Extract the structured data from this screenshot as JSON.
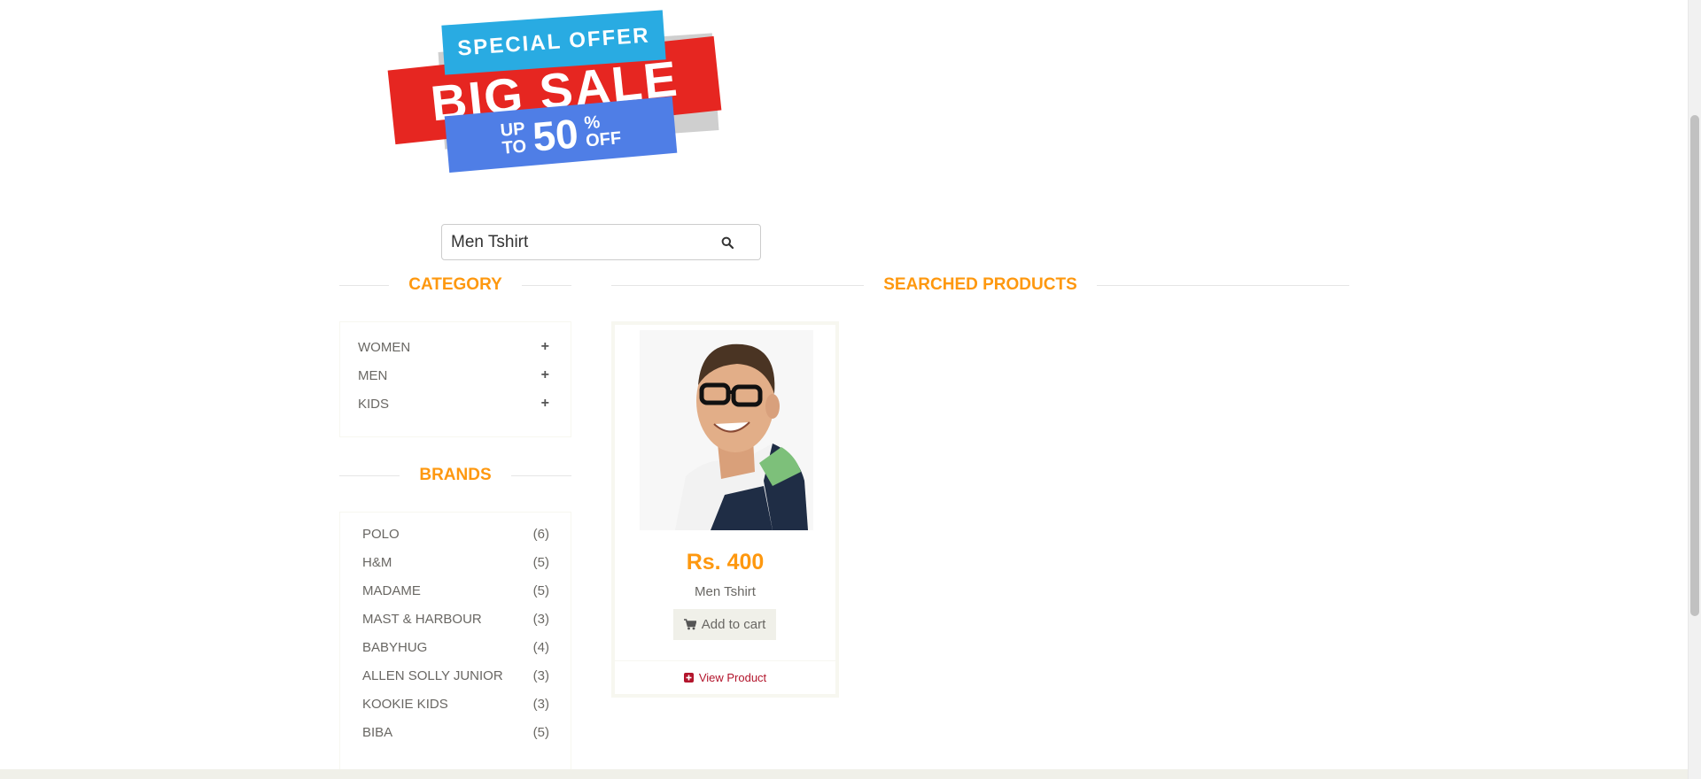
{
  "banner": {
    "line1": "SPECIAL OFFER",
    "line2": "BIG SALE",
    "upto_up": "UP",
    "upto_to": "TO",
    "amount": "50",
    "percent": "%",
    "off": "OFF"
  },
  "search": {
    "value": "Men Tshirt",
    "icon": "search-icon"
  },
  "category": {
    "heading": "CATEGORY",
    "items": [
      {
        "label": "WOMEN",
        "icon": "+"
      },
      {
        "label": "MEN",
        "icon": "+"
      },
      {
        "label": "KIDS",
        "icon": "+"
      }
    ]
  },
  "brands": {
    "heading": "BRANDS",
    "items": [
      {
        "label": "POLO",
        "count": "(6)"
      },
      {
        "label": "H&M",
        "count": "(5)"
      },
      {
        "label": "MADAME",
        "count": "(5)"
      },
      {
        "label": "MAST & HARBOUR",
        "count": "(3)"
      },
      {
        "label": "BABYHUG",
        "count": "(4)"
      },
      {
        "label": "ALLEN SOLLY JUNIOR",
        "count": "(3)"
      },
      {
        "label": "KOOKIE KIDS",
        "count": "(3)"
      },
      {
        "label": "BIBA",
        "count": "(5)"
      }
    ]
  },
  "results": {
    "heading": "SEARCHED PRODUCTS",
    "products": [
      {
        "price": "Rs. 400",
        "name": "Men Tshirt",
        "cart_label": "Add to cart",
        "view_label": "View Product"
      }
    ]
  },
  "colors": {
    "accent": "#fe980f",
    "link": "#b3152c"
  }
}
